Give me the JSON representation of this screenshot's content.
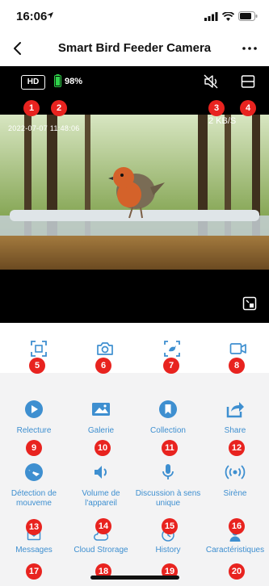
{
  "status_bar": {
    "time": "16:06"
  },
  "nav": {
    "title": "Smart Bird Feeder Camera"
  },
  "video": {
    "quality": "HD",
    "battery": "98%",
    "timestamp": "2022-07-07  11:48:06",
    "bitrate": "2 KB/S"
  },
  "markers": [
    "1",
    "2",
    "3",
    "4",
    "5",
    "6",
    "7",
    "8",
    "9",
    "10",
    "11",
    "12",
    "13",
    "14",
    "15",
    "16",
    "17",
    "18",
    "19",
    "20"
  ],
  "toolbar": [
    "screen-record-icon",
    "camera-icon",
    "bird-capture-icon",
    "video-record-icon"
  ],
  "menu": {
    "row1": [
      {
        "label": "Relecture",
        "icon": "playback-icon"
      },
      {
        "label": "Galerie",
        "icon": "gallery-icon"
      },
      {
        "label": "Collection",
        "icon": "bookmark-icon"
      },
      {
        "label": "Share",
        "icon": "share-icon"
      }
    ],
    "row2": [
      {
        "label": "Détection de mouveme",
        "icon": "motion-detection-icon"
      },
      {
        "label": "Volume de l'appareil",
        "icon": "volume-icon"
      },
      {
        "label": "Discussion à sens unique",
        "icon": "microphone-icon"
      },
      {
        "label": "Sirène",
        "icon": "siren-icon"
      }
    ],
    "row3": [
      {
        "label": "Messages",
        "icon": "mail-icon"
      },
      {
        "label": "Cloud Strorage",
        "icon": "cloud-icon"
      },
      {
        "label": "History",
        "icon": "clock-icon"
      },
      {
        "label": "Caractéristiques",
        "icon": "features-icon"
      }
    ]
  },
  "colors": {
    "accent": "#3e8fd0",
    "marker": "#e8231f",
    "battery": "#2fd14a"
  }
}
